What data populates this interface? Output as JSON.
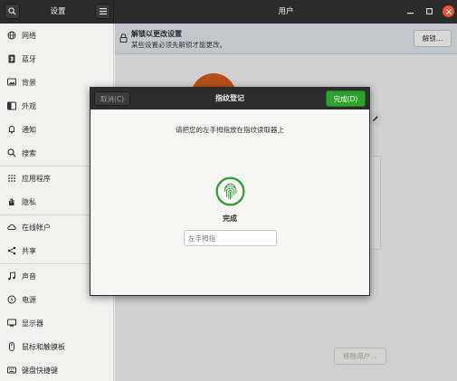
{
  "header": {
    "sidebar_title": "设置",
    "window_title": "用户",
    "icons": {
      "search": "search-icon",
      "menu": "hamburger-menu-icon",
      "minimize": "minimize-icon",
      "maximize": "maximize-icon",
      "close": "close-icon"
    },
    "close_color": "#e9542f"
  },
  "sidebar": {
    "items": [
      {
        "label": "网络",
        "icon": "network-icon"
      },
      {
        "label": "蓝牙",
        "icon": "bluetooth-icon"
      },
      {
        "label": "背景",
        "icon": "background-icon"
      },
      {
        "label": "外观",
        "icon": "appearance-icon"
      },
      {
        "label": "通知",
        "icon": "bell-icon"
      },
      {
        "label": "搜索",
        "icon": "search-icon"
      },
      {
        "label": "应用程序",
        "icon": "apps-grid-icon"
      },
      {
        "label": "隐私",
        "icon": "privacy-hand-icon"
      },
      {
        "label": "在线帐户",
        "icon": "cloud-icon"
      },
      {
        "label": "共享",
        "icon": "share-icon"
      },
      {
        "label": "声音",
        "icon": "music-note-icon"
      },
      {
        "label": "电源",
        "icon": "power-icon"
      },
      {
        "label": "显示器",
        "icon": "display-icon"
      },
      {
        "label": "鼠标和触摸板",
        "icon": "mouse-icon"
      },
      {
        "label": "键盘快捷键",
        "icon": "keyboard-icon"
      }
    ]
  },
  "main": {
    "infobar": {
      "title": "解锁以更改设置",
      "subtitle": "某些设置必须先解锁才能更改。",
      "unlock_label": "解锁…",
      "icon": "lock-icon"
    },
    "remove_user_label": "移除用户…"
  },
  "dialog": {
    "title": "指纹登记",
    "cancel_label": "取消(C)",
    "done_label": "完成(D)",
    "instruction": "请把您的左手拇指放在指纹读取器上",
    "status": "完成",
    "finger_field_placeholder": "左手拇指",
    "icon": "fingerprint-icon",
    "accent_color": "#2ea22f"
  }
}
